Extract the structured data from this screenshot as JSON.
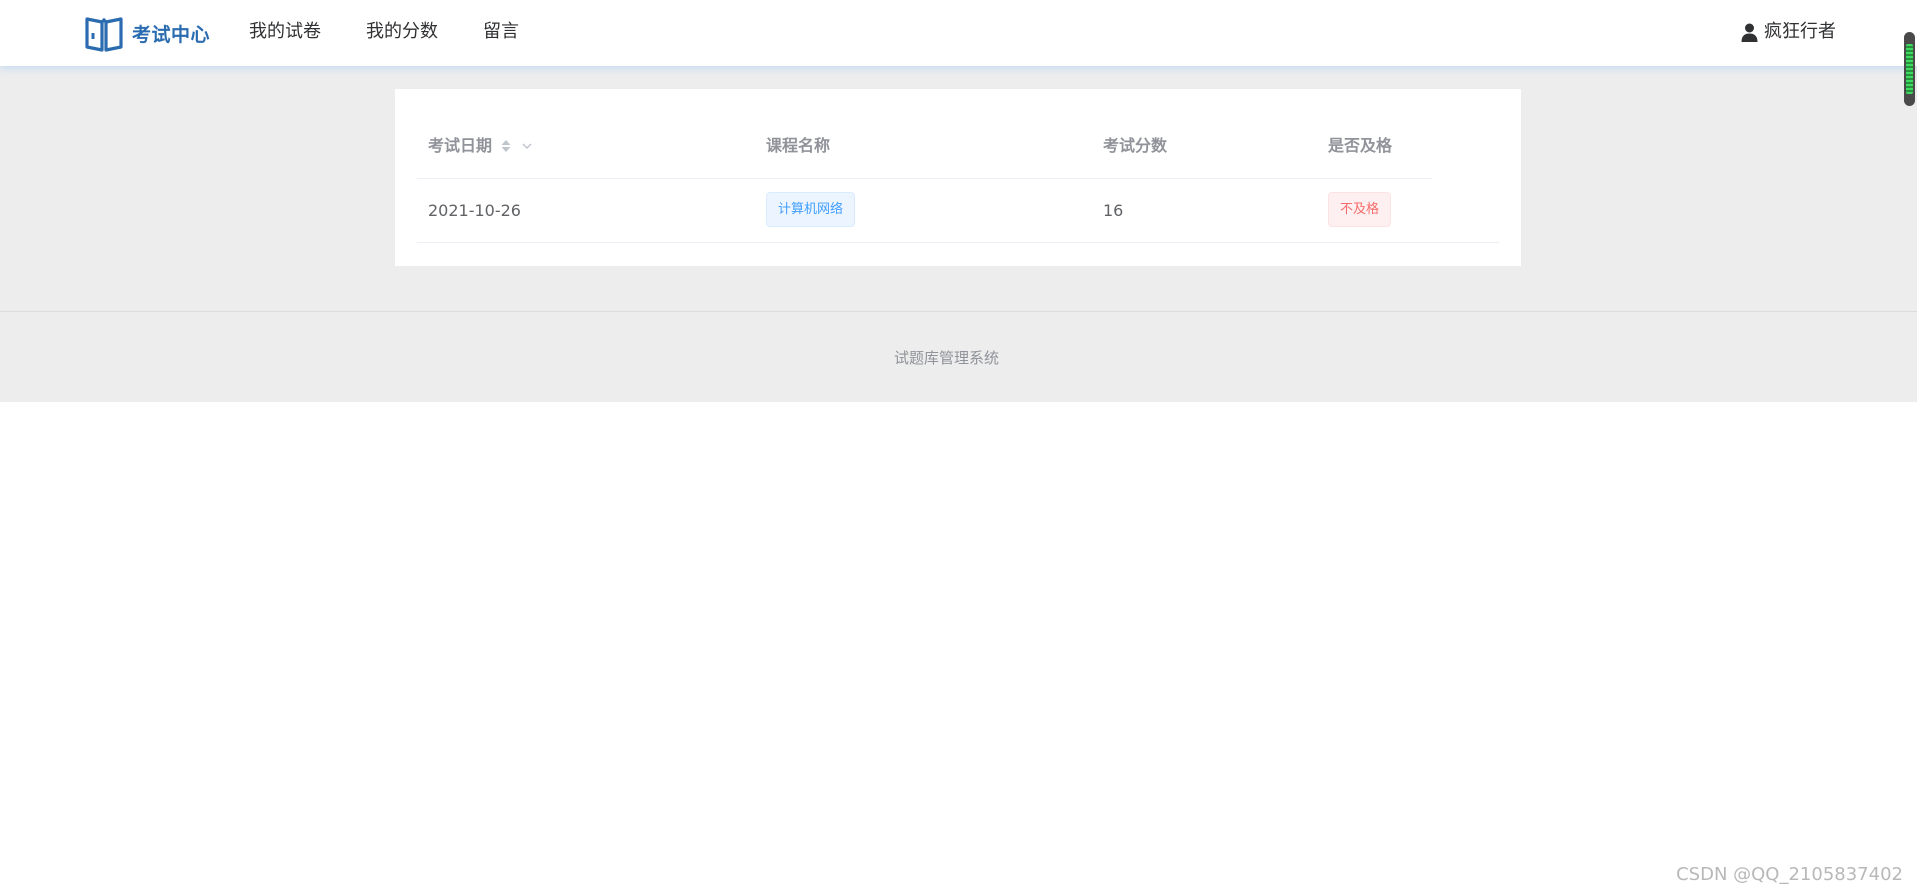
{
  "header": {
    "brand": "考试中心",
    "nav": [
      "我的试卷",
      "我的分数",
      "留言"
    ],
    "user_name": "疯狂行者",
    "icons": {
      "logo": "open-book-icon",
      "user": "user-icon"
    }
  },
  "table": {
    "columns": [
      "考试日期",
      "课程名称",
      "考试分数",
      "是否及格"
    ],
    "rows": [
      {
        "date": "2021-10-26",
        "course": "计算机网络",
        "score": "16",
        "pass": "不及格"
      }
    ]
  },
  "footer": {
    "text": "试题库管理系统"
  },
  "watermark": "CSDN @QQ_2105837402",
  "colors": {
    "brand": "#2b6cb0",
    "tag_course": "#409eff",
    "tag_fail": "#f56c6c",
    "page_bg": "#ededed"
  }
}
